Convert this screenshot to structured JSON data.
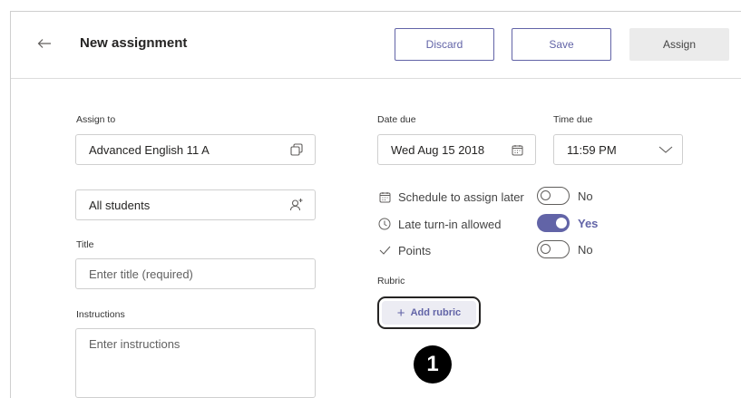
{
  "header": {
    "title": "New assignment",
    "back_icon": "arrow-left-icon",
    "discard_label": "Discard",
    "save_label": "Save",
    "assign_label": "Assign"
  },
  "form": {
    "assign_to_label": "Assign to",
    "assign_to_value": "Advanced English 11 A",
    "students_value": "All students",
    "title_label": "Title",
    "title_placeholder": "Enter title (required)",
    "instructions_label": "Instructions",
    "instructions_placeholder": "Enter instructions",
    "date_due_label": "Date due",
    "date_due_value": "Wed Aug 15 2018",
    "time_due_label": "Time due",
    "time_due_value": "11:59 PM"
  },
  "options": [
    {
      "label": "Schedule to assign later",
      "icon": "calendar-icon",
      "state": "No",
      "on": false
    },
    {
      "label": "Late turn-in allowed",
      "icon": "clock-icon",
      "state": "Yes",
      "on": true
    },
    {
      "label": "Points",
      "icon": "check-icon",
      "state": "No",
      "on": false
    }
  ],
  "rubric": {
    "label": "Rubric",
    "add_label": "Add rubric"
  },
  "callout": {
    "number": "1"
  },
  "colors": {
    "accent": "#6264a7",
    "text": "#252423",
    "border": "#cfcfcf",
    "assign_bg": "#ebebeb"
  }
}
